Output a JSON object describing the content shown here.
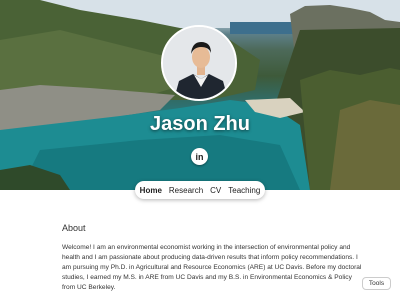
{
  "profile": {
    "name": "Jason Zhu"
  },
  "social": {
    "linkedin_glyph": "in",
    "icon": "linkedin-icon"
  },
  "nav": {
    "items": [
      {
        "label": "Home",
        "active": true
      },
      {
        "label": "Research",
        "active": false
      },
      {
        "label": "CV",
        "active": false
      },
      {
        "label": "Teaching",
        "active": false
      }
    ]
  },
  "about": {
    "title": "About",
    "bio": "Welcome! I am an environmental economist working in the intersection of environmental policy and health and I am passionate about producing data-driven results that inform policy recommendations. I am pursuing my Ph.D. in Agricultural and Resource Economics (ARE) at UC Davis. Before my doctoral studies, I earned my M.S. in ARE from UC Davis and my B.S. in Environmental Economics & Policy from UC Berkeley."
  },
  "tools": {
    "label": "Tools"
  }
}
